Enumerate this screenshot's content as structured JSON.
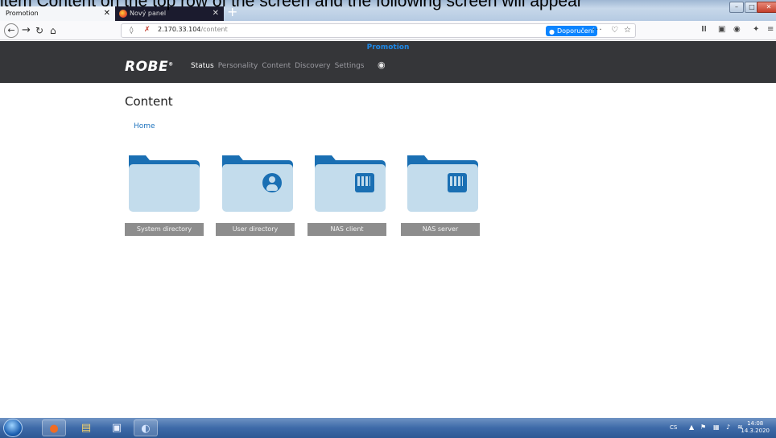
{
  "caption": "item Content on the top row of the screen and the following screen will appear",
  "browser": {
    "tabs": [
      {
        "label": "Promotion",
        "active": true
      },
      {
        "label": "Nový panel",
        "active": false
      }
    ],
    "new_tab_icon": "plus-icon",
    "url_host": "2.170.33.104",
    "url_path": "/content",
    "recommend_button": "Doporučení",
    "overflow_label": "···"
  },
  "site": {
    "subtitle": "Promotion",
    "logo": "ROBE",
    "logo_mark": "®",
    "menu": [
      "Status",
      "Personality",
      "Content",
      "Discovery",
      "Settings"
    ],
    "active_menu": "Status",
    "eye_icon": "eye-icon"
  },
  "page": {
    "title": "Content",
    "breadcrumb": "Home"
  },
  "folders": [
    {
      "label": "System directory",
      "icon": "folder-icon"
    },
    {
      "label": "User directory",
      "icon": "user-folder-icon"
    },
    {
      "label": "NAS client",
      "icon": "nas-folder-icon"
    },
    {
      "label": "NAS server",
      "icon": "nas-folder-icon"
    }
  ],
  "taskbar": {
    "language": "CS",
    "time": "14:08",
    "date": "14.3.2020"
  },
  "colors": {
    "accent": "#1e88e5",
    "header_bg": "#353639",
    "folder_dark": "#1a6fb3",
    "folder_light": "#c3dcec",
    "label_bg": "#8d8d8d"
  }
}
